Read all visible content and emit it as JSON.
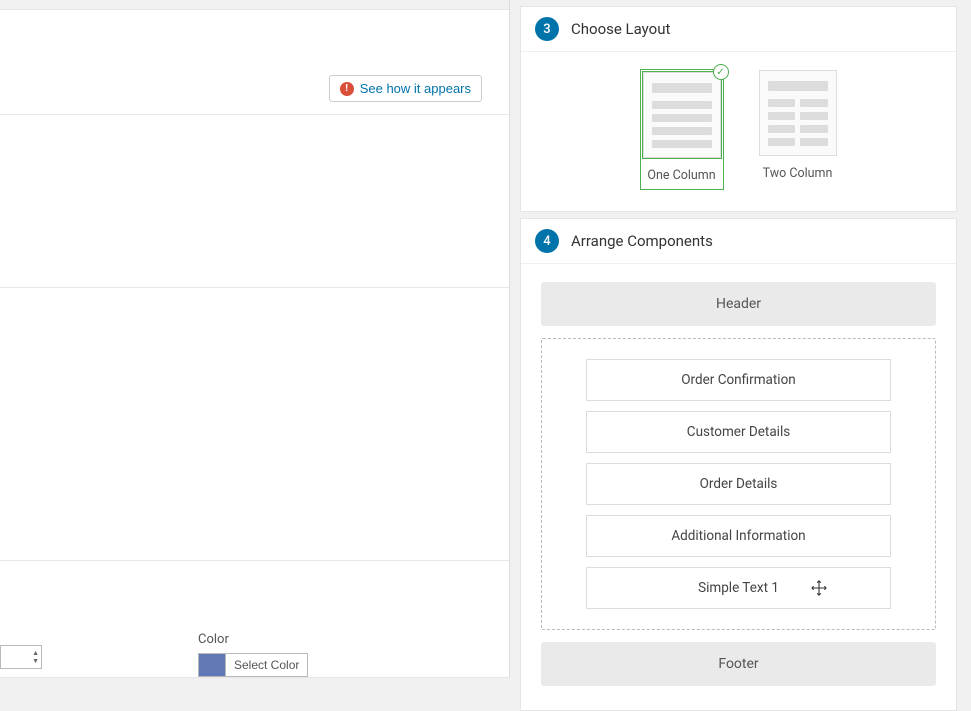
{
  "left": {
    "see_how_label": "See how it appears",
    "color_label": "Color",
    "select_color_label": "Select Color",
    "swatch_hex": "#6079b6"
  },
  "steps": {
    "layout": {
      "num": "3",
      "title": "Choose Layout",
      "options": [
        {
          "label": "One Column",
          "selected": true
        },
        {
          "label": "Two Column",
          "selected": false
        }
      ]
    },
    "arrange": {
      "num": "4",
      "title": "Arrange Components",
      "header_label": "Header",
      "footer_label": "Footer",
      "components": [
        "Order Confirmation",
        "Customer Details",
        "Order Details",
        "Additional Information",
        "Simple Text 1"
      ]
    }
  }
}
